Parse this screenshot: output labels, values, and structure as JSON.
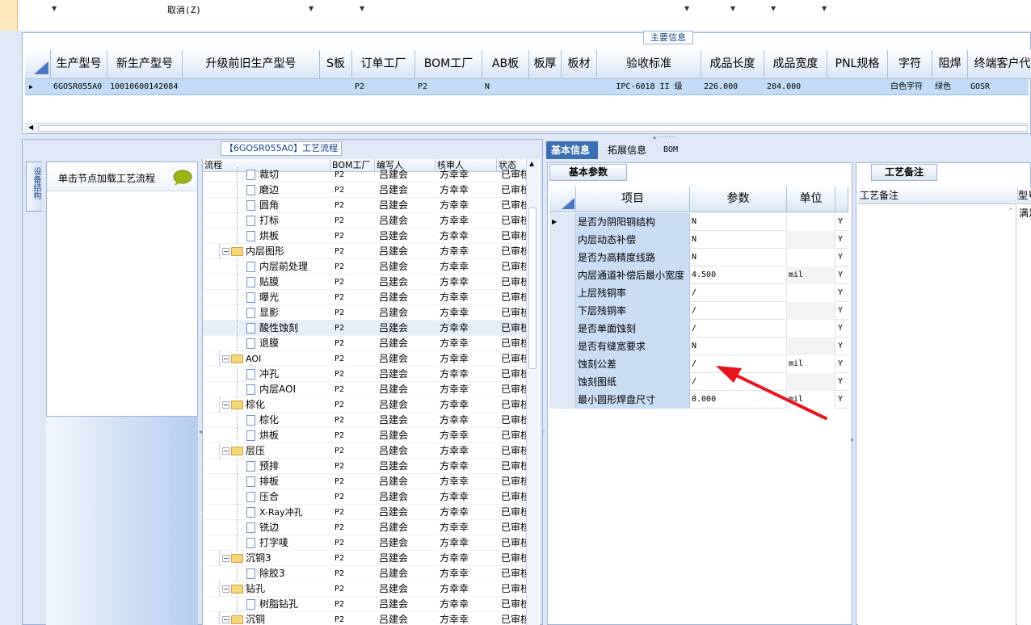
{
  "toolbar": {
    "cancel_label": "取消(Z)"
  },
  "main_info": {
    "title": "主要信息",
    "columns": [
      "生产型号",
      "新生产型号",
      "升级前旧生产型号",
      "S板",
      "订单工厂",
      "BOM工厂",
      "AB板",
      "板厚",
      "板材",
      "验收标准",
      "成品长度",
      "成品宽度",
      "PNL规格",
      "字符",
      "阻焊",
      "终端客户代码"
    ],
    "row": [
      "6GOSR055A0",
      "10010600142084",
      "",
      "",
      "P2",
      "P2",
      "N",
      "",
      "",
      "IPC-6018 II 级",
      "226.000",
      "204.000",
      "",
      "白色字符",
      "绿色",
      "GOSR"
    ]
  },
  "left_panel": {
    "vtab_label": "设备结构",
    "help_text": "单击节点加载工艺流程",
    "process_title": "【6GOSR055A0】工艺流程",
    "grid_headers": [
      "流程",
      "BOM工厂",
      "编写人",
      "核审人",
      "状态"
    ],
    "rows": [
      {
        "name": "裁切",
        "level": 2,
        "type": "doc",
        "factory": "P2",
        "writer": "吕建会",
        "reviewer": "方幸幸",
        "status": "已审核"
      },
      {
        "name": "磨边",
        "level": 2,
        "type": "doc",
        "factory": "P2",
        "writer": "吕建会",
        "reviewer": "方幸幸",
        "status": "已审核"
      },
      {
        "name": "圆角",
        "level": 2,
        "type": "doc",
        "factory": "P2",
        "writer": "吕建会",
        "reviewer": "方幸幸",
        "status": "已审核"
      },
      {
        "name": "打标",
        "level": 2,
        "type": "doc",
        "factory": "P2",
        "writer": "吕建会",
        "reviewer": "方幸幸",
        "status": "已审核"
      },
      {
        "name": "烘板",
        "level": 2,
        "type": "doc",
        "factory": "P2",
        "writer": "吕建会",
        "reviewer": "方幸幸",
        "status": "已审核"
      },
      {
        "name": "内层图形",
        "level": 1,
        "type": "folder",
        "factory": "P2",
        "writer": "吕建会",
        "reviewer": "方幸幸",
        "status": "已审核"
      },
      {
        "name": "内层前处理",
        "level": 2,
        "type": "doc",
        "factory": "P2",
        "writer": "吕建会",
        "reviewer": "方幸幸",
        "status": "已审核"
      },
      {
        "name": "贴膜",
        "level": 2,
        "type": "doc",
        "factory": "P2",
        "writer": "吕建会",
        "reviewer": "方幸幸",
        "status": "已审核"
      },
      {
        "name": "曝光",
        "level": 2,
        "type": "doc",
        "factory": "P2",
        "writer": "吕建会",
        "reviewer": "方幸幸",
        "status": "已审核"
      },
      {
        "name": "显影",
        "level": 2,
        "type": "doc",
        "factory": "P2",
        "writer": "吕建会",
        "reviewer": "方幸幸",
        "status": "已审核"
      },
      {
        "name": "酸性蚀刻",
        "level": 2,
        "type": "doc",
        "factory": "P2",
        "writer": "吕建会",
        "reviewer": "方幸幸",
        "status": "已审核",
        "selected": true
      },
      {
        "name": "退膜",
        "level": 2,
        "type": "doc",
        "factory": "P2",
        "writer": "吕建会",
        "reviewer": "方幸幸",
        "status": "已审核"
      },
      {
        "name": "AOI",
        "level": 1,
        "type": "folder",
        "factory": "P2",
        "writer": "吕建会",
        "reviewer": "方幸幸",
        "status": "已审核"
      },
      {
        "name": "冲孔",
        "level": 2,
        "type": "doc",
        "factory": "P2",
        "writer": "吕建会",
        "reviewer": "方幸幸",
        "status": "已审核"
      },
      {
        "name": "内层AOI",
        "level": 2,
        "type": "doc",
        "factory": "P2",
        "writer": "吕建会",
        "reviewer": "方幸幸",
        "status": "已审核"
      },
      {
        "name": "棕化",
        "level": 1,
        "type": "folder",
        "factory": "P2",
        "writer": "吕建会",
        "reviewer": "方幸幸",
        "status": "已审核"
      },
      {
        "name": "棕化",
        "level": 2,
        "type": "doc",
        "factory": "P2",
        "writer": "吕建会",
        "reviewer": "方幸幸",
        "status": "已审核"
      },
      {
        "name": "烘板",
        "level": 2,
        "type": "doc",
        "factory": "P2",
        "writer": "吕建会",
        "reviewer": "方幸幸",
        "status": "已审核"
      },
      {
        "name": "层压",
        "level": 1,
        "type": "folder",
        "factory": "P2",
        "writer": "吕建会",
        "reviewer": "方幸幸",
        "status": "已审核"
      },
      {
        "name": "预排",
        "level": 2,
        "type": "doc",
        "factory": "P2",
        "writer": "吕建会",
        "reviewer": "方幸幸",
        "status": "已审核"
      },
      {
        "name": "排板",
        "level": 2,
        "type": "doc",
        "factory": "P2",
        "writer": "吕建会",
        "reviewer": "方幸幸",
        "status": "已审核"
      },
      {
        "name": "压合",
        "level": 2,
        "type": "doc",
        "factory": "P2",
        "writer": "吕建会",
        "reviewer": "方幸幸",
        "status": "已审核"
      },
      {
        "name": "X-Ray冲孔",
        "level": 2,
        "type": "doc",
        "factory": "P2",
        "writer": "吕建会",
        "reviewer": "方幸幸",
        "status": "已审核"
      },
      {
        "name": "铣边",
        "level": 2,
        "type": "doc",
        "factory": "P2",
        "writer": "吕建会",
        "reviewer": "方幸幸",
        "status": "已审核"
      },
      {
        "name": "打字唛",
        "level": 2,
        "type": "doc",
        "factory": "P2",
        "writer": "吕建会",
        "reviewer": "方幸幸",
        "status": "已审核"
      },
      {
        "name": "沉铜3",
        "level": 1,
        "type": "folder",
        "factory": "P2",
        "writer": "吕建会",
        "reviewer": "方幸幸",
        "status": "已审核"
      },
      {
        "name": "除胶3",
        "level": 2,
        "type": "doc",
        "factory": "P2",
        "writer": "吕建会",
        "reviewer": "方幸幸",
        "status": "已审核"
      },
      {
        "name": "钻孔",
        "level": 1,
        "type": "folder",
        "factory": "P2",
        "writer": "吕建会",
        "reviewer": "方幸幸",
        "status": "已审核"
      },
      {
        "name": "树脂钻孔",
        "level": 2,
        "type": "doc",
        "factory": "P2",
        "writer": "吕建会",
        "reviewer": "方幸幸",
        "status": "已审核"
      },
      {
        "name": "沉铜",
        "level": 1,
        "type": "folder",
        "factory": "P2",
        "writer": "吕建会",
        "reviewer": "方幸幸",
        "status": "已审核"
      }
    ]
  },
  "right_tabs": [
    "基本信息",
    "拓展信息",
    "BOM"
  ],
  "basic_params": {
    "subtab": "基本参数",
    "headers": [
      "项目",
      "参数",
      "单位"
    ],
    "rows": [
      {
        "item": "是否为阴阳铜结构",
        "param": "N",
        "unit": "",
        "flag": "Y"
      },
      {
        "item": "内层动态补偿",
        "param": "N",
        "unit": "",
        "flag": "Y"
      },
      {
        "item": "是否为高精度线路",
        "param": "N",
        "unit": "",
        "flag": "Y"
      },
      {
        "item": "内层通道补偿后最小宽度",
        "param": "4.500",
        "unit": "mil",
        "flag": "Y"
      },
      {
        "item": "上层残铜率",
        "param": "/",
        "unit": "",
        "flag": "Y"
      },
      {
        "item": "下层残铜率",
        "param": "/",
        "unit": "",
        "flag": "Y"
      },
      {
        "item": "是否单面蚀刻",
        "param": "/",
        "unit": "",
        "flag": "Y"
      },
      {
        "item": "是否有缝宽要求",
        "param": "N",
        "unit": "",
        "flag": "Y"
      },
      {
        "item": "蚀刻公差",
        "param": "/",
        "unit": "mil",
        "flag": "Y"
      },
      {
        "item": "蚀刻图纸",
        "param": "/",
        "unit": "",
        "flag": "Y"
      },
      {
        "item": "最小圆形焊盘尺寸",
        "param": "0.000",
        "unit": "mil",
        "flag": "Y"
      }
    ]
  },
  "craft_notes": {
    "tab": "工艺备注",
    "header": "工艺备注",
    "header2": "型号",
    "cell": "满足"
  },
  "colors": {
    "annotation_arrow": "#e8141e",
    "selection": "#c2dcf7",
    "accent": "#3b6fb6"
  }
}
